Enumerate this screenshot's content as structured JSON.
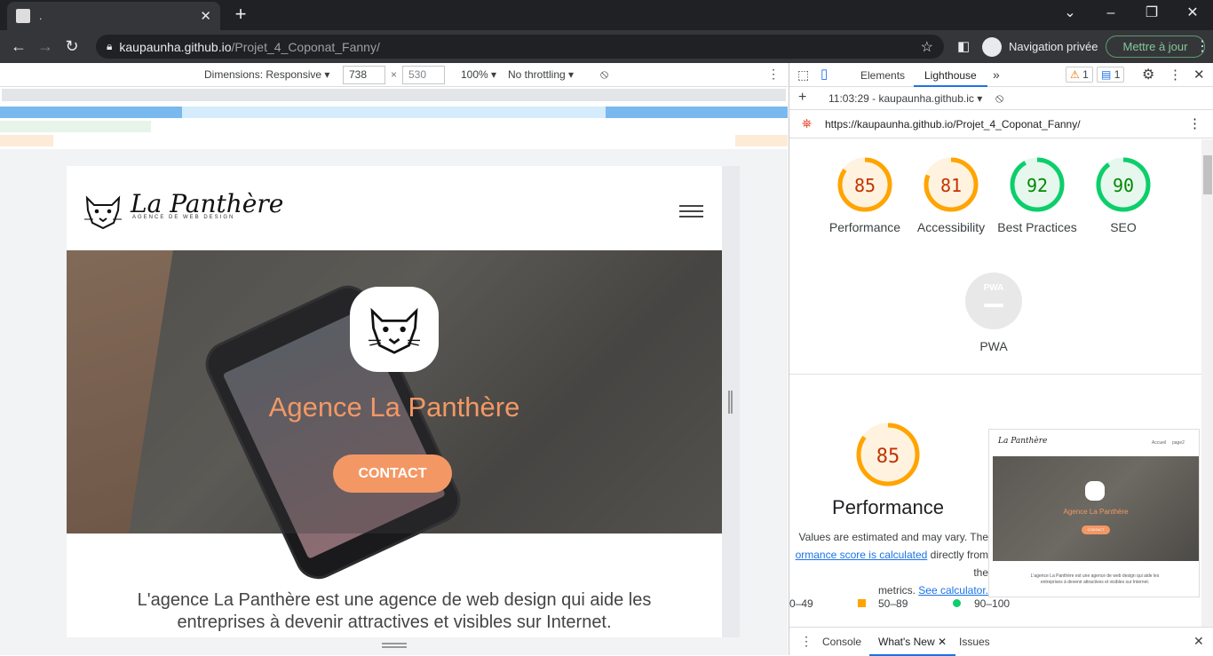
{
  "browser": {
    "tab_title": ".",
    "url_host": "kaupaunha.github.io",
    "url_path": "/Projet_4_Coponat_Fanny/",
    "incognito_label": "Navigation privée",
    "update_label": "Mettre à jour"
  },
  "device_toolbar": {
    "dimensions_label": "Dimensions: Responsive",
    "width": "738",
    "height": "530",
    "zoom": "100%",
    "throttling": "No throttling"
  },
  "site": {
    "brand_name": "La Panthère",
    "brand_tagline": "AGENCE DE WEB DESIGN",
    "hero_title": "Agence La Panthère",
    "contact_label": "CONTACT",
    "intro_text": "L'agence La Panthère est une agence de web design qui aide les entreprises à devenir attractives et visibles sur Internet."
  },
  "devtools": {
    "tabs": [
      "Elements",
      "Lighthouse"
    ],
    "warnings_count": "1",
    "messages_count": "1",
    "report_time": "11:03:29 - kaupaunha.github.ic",
    "report_url": "https://kaupaunha.github.io/Projet_4_Coponat_Fanny/",
    "scores": [
      {
        "label": "Performance",
        "value": "85",
        "fraction": 0.85,
        "color": "#ffa400",
        "bg": "#fff3e0",
        "text_color": "#c33300"
      },
      {
        "label": "Accessibility",
        "value": "81",
        "fraction": 0.81,
        "color": "#ffa400",
        "bg": "#fff3e0",
        "text_color": "#c33300"
      },
      {
        "label": "Best Practices",
        "value": "92",
        "fraction": 0.92,
        "color": "#0cce6b",
        "bg": "#e6f8ee",
        "text_color": "#008800"
      },
      {
        "label": "SEO",
        "value": "90",
        "fraction": 0.9,
        "color": "#0cce6b",
        "bg": "#e6f8ee",
        "text_color": "#008800"
      }
    ],
    "pwa_label": "PWA",
    "pwa_badge": "PWA",
    "perf_score": "85",
    "perf_title": "Performance",
    "perf_note_1": "Values are estimated and may vary. The",
    "perf_link_1": "ormance score is calculated",
    "perf_note_2": "directly from the",
    "perf_note_3": "metrics.",
    "perf_link_2": "See calculator.",
    "legend": [
      "0–49",
      "50–89",
      "90–100"
    ],
    "thumb_brand": "La Panthère",
    "thumb_nav_1": "Accueil",
    "thumb_nav_2": "page2",
    "thumb_title": "Agence La Panthère",
    "thumb_contact": "CONTACT",
    "thumb_intro": "L'agence La Panthère est une agence de web design qui aide les entreprises à devenir attractives et visibles sur Internet.",
    "drawer_tabs": [
      "Console",
      "What's New",
      "Issues"
    ]
  }
}
